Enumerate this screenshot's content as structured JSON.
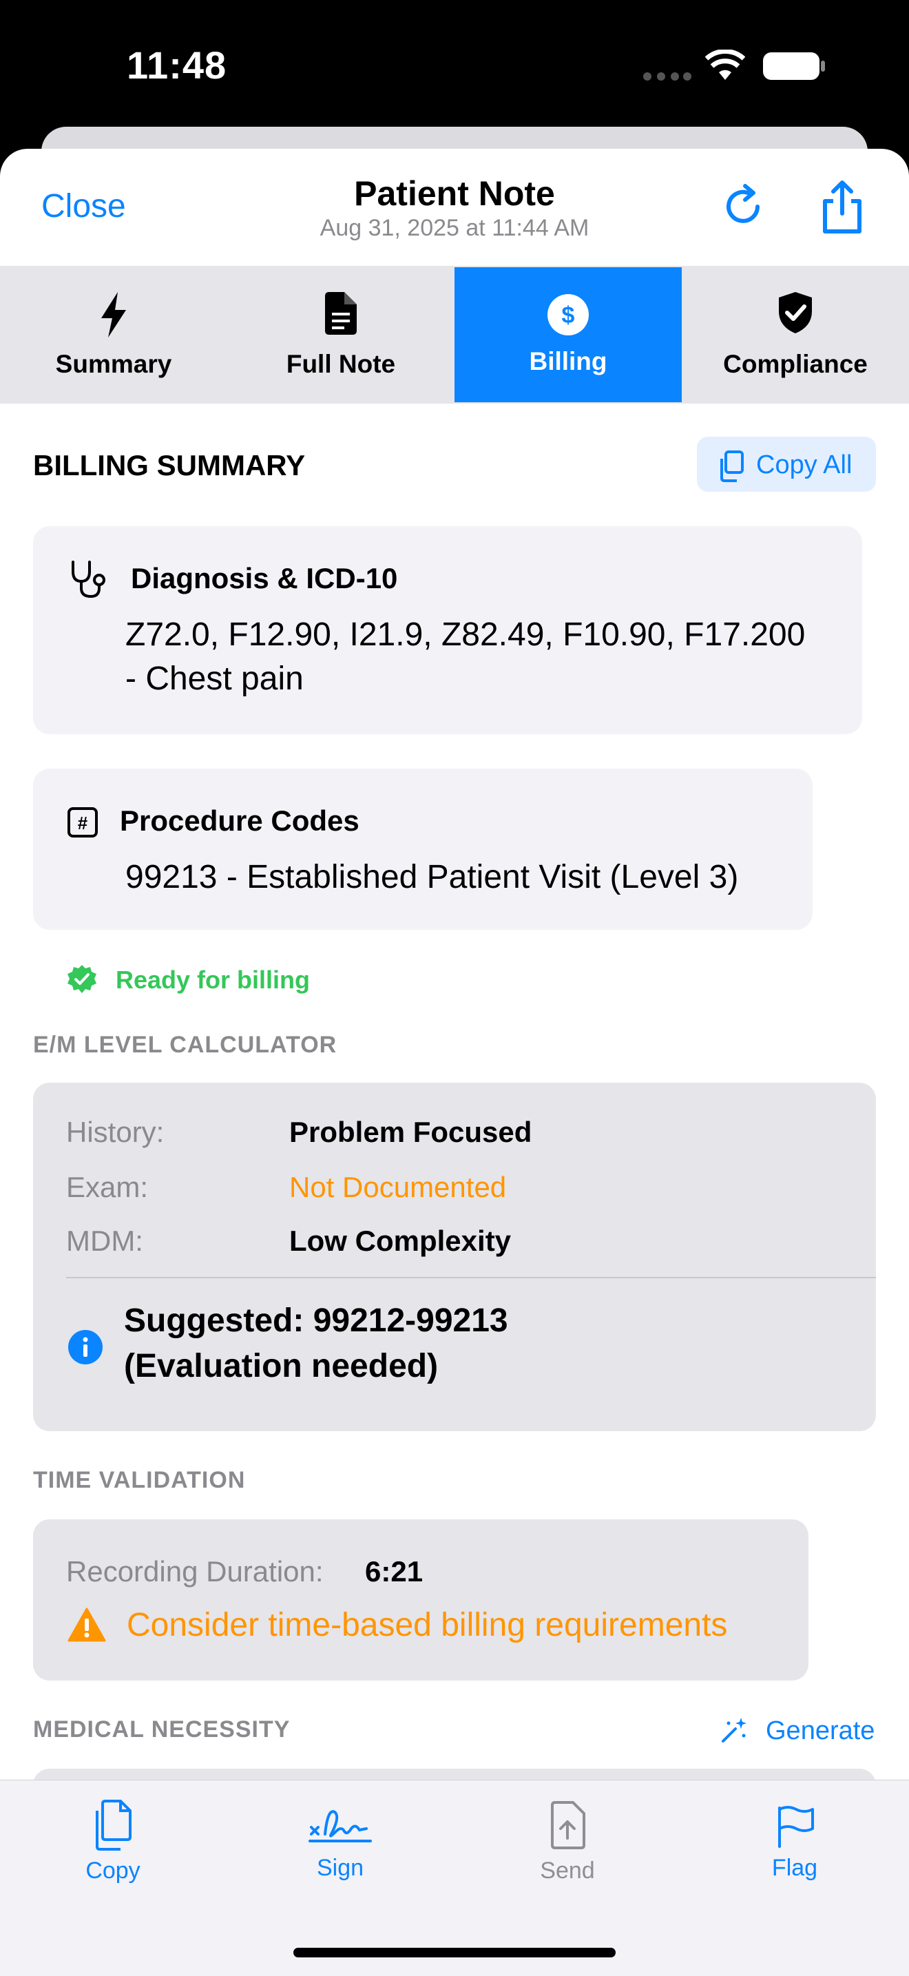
{
  "status_bar": {
    "time": "11:48"
  },
  "nav": {
    "close": "Close",
    "title": "Patient Note",
    "subtitle": "Aug 31, 2025 at 11:44 AM",
    "refresh_icon": "refresh-icon",
    "share_icon": "share-icon"
  },
  "tabs": [
    {
      "label": "Summary",
      "icon": "bolt-icon"
    },
    {
      "label": "Full Note",
      "icon": "document-icon"
    },
    {
      "label": "Billing",
      "icon": "dollar-icon",
      "active": true
    },
    {
      "label": "Compliance",
      "icon": "shield-check-icon"
    }
  ],
  "billing": {
    "heading": "BILLING SUMMARY",
    "copy_all": "Copy All",
    "diagnosis": {
      "title": "Diagnosis & ICD-10",
      "line1": "Z72.0, F12.90, I21.9, Z82.49, F10.90, F17.200",
      "line2": "- Chest pain"
    },
    "procedure": {
      "title": "Procedure Codes",
      "value": "99213 - Established Patient Visit (Level 3)"
    },
    "ready": "Ready for billing"
  },
  "em": {
    "heading": "E/M LEVEL CALCULATOR",
    "rows": [
      {
        "label": "History:",
        "value": "Problem Focused"
      },
      {
        "label": "Exam:",
        "value": "Not Documented"
      },
      {
        "label": "MDM:",
        "value": "Low Complexity"
      }
    ],
    "suggested_line1": "Suggested: 99212-99213",
    "suggested_line2": "(Evaluation needed)"
  },
  "time_validation": {
    "heading": "TIME VALIDATION",
    "duration_label": "Recording Duration:",
    "duration_value": "6:21",
    "warning": "Consider time-based billing requirements"
  },
  "medical_necessity": {
    "heading": "MEDICAL NECESSITY",
    "generate": "Generate"
  },
  "toolbar": {
    "copy": "Copy",
    "sign": "Sign",
    "send": "Send",
    "flag": "Flag"
  },
  "colors": {
    "accent": "#0a84ff",
    "warning": "#ff9500",
    "success": "#34c759"
  }
}
